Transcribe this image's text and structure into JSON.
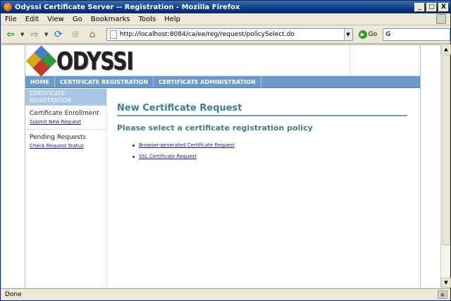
{
  "window": {
    "title": "Odyssi Certificate Server -- Registration - Mozilla Firefox",
    "buttons": {
      "minimize": "_",
      "maximize": "□",
      "close": "X"
    }
  },
  "menu": [
    "File",
    "Edit",
    "View",
    "Go",
    "Bookmarks",
    "Tools",
    "Help"
  ],
  "toolbar": {
    "url": "http://localhost:8084/ca/ee/reg/request/policySelect.do",
    "go_label": "Go",
    "search_value": "G",
    "icons": [
      "back-arrow-icon",
      "forward-arrow-icon",
      "reload-icon",
      "stop-icon",
      "home-icon"
    ]
  },
  "site": {
    "logo_text": "ODYSSI",
    "nav": [
      "HOME",
      "CERTIFICATE REGISTRATION",
      "CERTIFICATE ADMINISTRATION"
    ],
    "colors": {
      "nav": "#6b9ac6",
      "heading": "#3f7e84",
      "sidebar_head": "#a9c6e4"
    }
  },
  "sidebar": {
    "header": "CERTIFICATE REGISTRATION",
    "sections": [
      {
        "title": "Certificate Enrollment",
        "links": [
          "Submit New Request"
        ]
      },
      {
        "title": "Pending Requests",
        "links": [
          "Check Request Status"
        ]
      }
    ]
  },
  "main": {
    "title": "New Certificate Request",
    "subtitle": "Please select a certificate registration policy",
    "options": [
      "Browser-generated Certificate Request",
      "SSL Certificate Request"
    ]
  },
  "status": {
    "text": "Done"
  }
}
